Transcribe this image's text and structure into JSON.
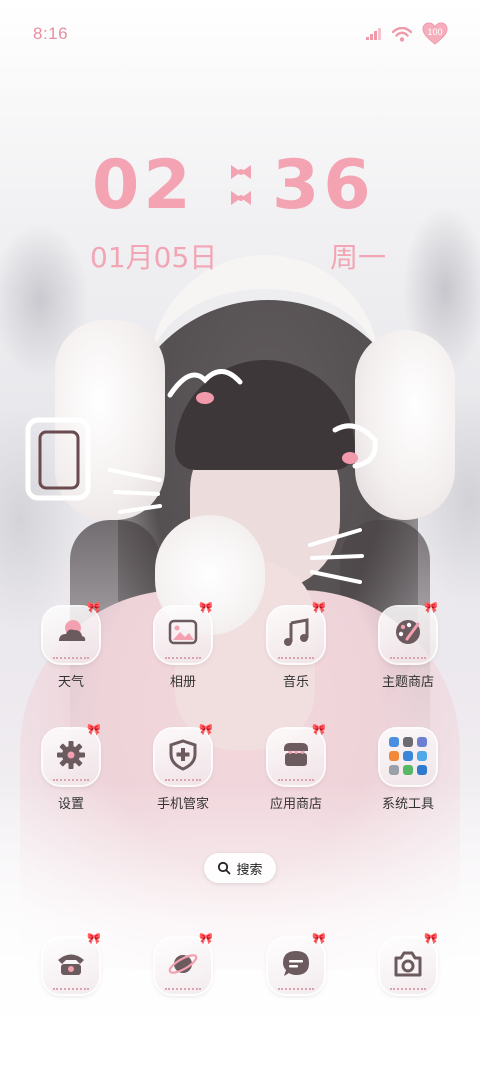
{
  "status_bar": {
    "time": "8:16",
    "battery": "100",
    "accent_color": "#e88ea0"
  },
  "clock_widget": {
    "hour": "02",
    "minute": "36",
    "date": "01月05日",
    "weekday": "周一",
    "color": "#f4a3b3"
  },
  "apps": {
    "row1": [
      {
        "label": "天气",
        "icon": "weather-icon"
      },
      {
        "label": "相册",
        "icon": "gallery-icon"
      },
      {
        "label": "音乐",
        "icon": "music-icon"
      },
      {
        "label": "主题商店",
        "icon": "palette-icon"
      }
    ],
    "row2": [
      {
        "label": "设置",
        "icon": "gear-icon"
      },
      {
        "label": "手机管家",
        "icon": "shield-icon"
      },
      {
        "label": "应用商店",
        "icon": "store-icon"
      },
      {
        "label": "系统工具",
        "icon": "folder-icon"
      }
    ]
  },
  "search": {
    "label": "搜索"
  },
  "dock": [
    {
      "icon": "phone-icon"
    },
    {
      "icon": "browser-icon"
    },
    {
      "icon": "message-icon"
    },
    {
      "icon": "camera-icon"
    }
  ]
}
